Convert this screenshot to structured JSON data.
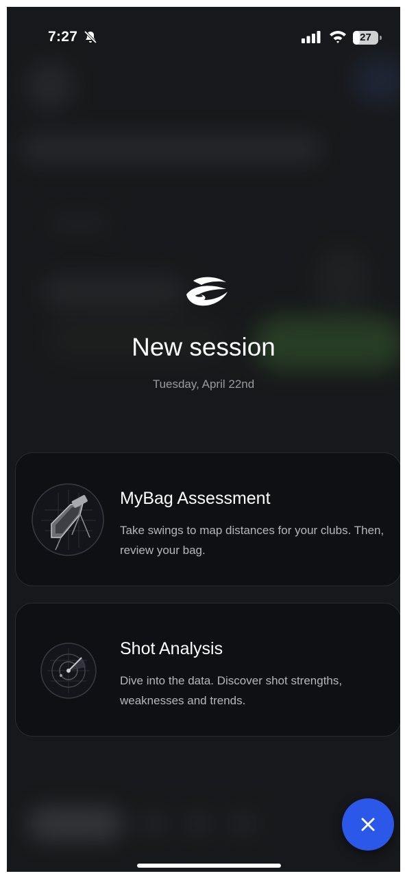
{
  "status_bar": {
    "time": "7:27",
    "battery_level": "27",
    "battery_fraction": 0.27,
    "icons": [
      "bell-off-icon",
      "signal-icon",
      "wifi-icon",
      "battery-icon"
    ]
  },
  "header": {
    "logo": "brand-logo-icon",
    "title": "New session",
    "date": "Tuesday, April 22nd"
  },
  "options": [
    {
      "id": "mybag",
      "icon": "golf-club-icon",
      "title": "MyBag Assessment",
      "description": "Take swings to map distances for your clubs. Then, review your bag."
    },
    {
      "id": "shot-analysis",
      "icon": "radar-icon",
      "title": "Shot Analysis",
      "description": "Dive into the data. Discover shot strengths, weaknesses and trends."
    }
  ],
  "fab": {
    "icon": "close-icon",
    "color": "#2b58e8"
  }
}
